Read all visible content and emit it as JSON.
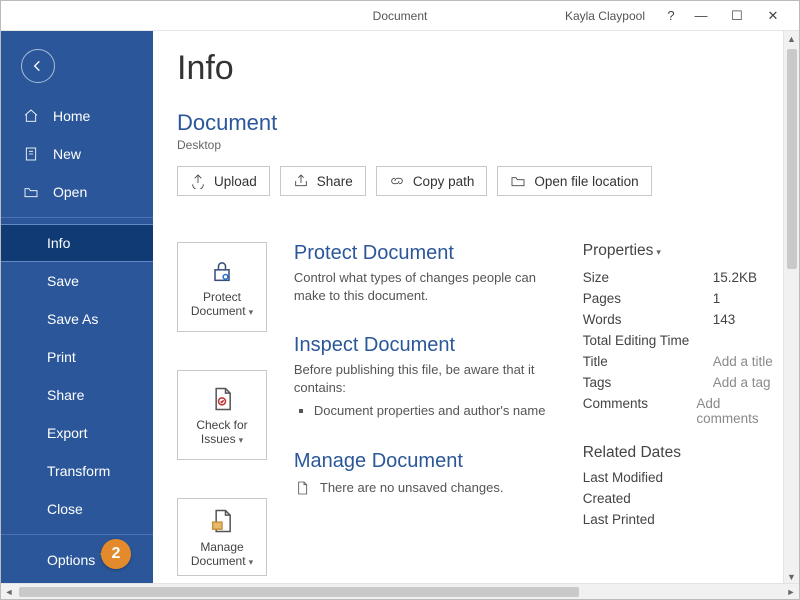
{
  "window": {
    "title": "Document",
    "user": "Kayla Claypool"
  },
  "sidebar": {
    "items": [
      {
        "label": "Home",
        "icon": true
      },
      {
        "label": "New",
        "icon": true
      },
      {
        "label": "Open",
        "icon": true
      },
      {
        "label": "Info",
        "icon": false,
        "active": true
      },
      {
        "label": "Save",
        "icon": false
      },
      {
        "label": "Save As",
        "icon": false
      },
      {
        "label": "Print",
        "icon": false
      },
      {
        "label": "Share",
        "icon": false
      },
      {
        "label": "Export",
        "icon": false
      },
      {
        "label": "Transform",
        "icon": false
      },
      {
        "label": "Close",
        "icon": false
      },
      {
        "label": "Options",
        "icon": false
      }
    ]
  },
  "page": {
    "title": "Info",
    "doc_name": "Document",
    "doc_location": "Desktop"
  },
  "actions": {
    "upload": "Upload",
    "share": "Share",
    "copy_path": "Copy path",
    "open_loc": "Open file location"
  },
  "sections": {
    "protect": {
      "tile": "Protect Document",
      "title": "Protect Document",
      "desc": "Control what types of changes people can make to this document."
    },
    "inspect": {
      "tile": "Check for Issues",
      "title": "Inspect Document",
      "desc": "Before publishing this file, be aware that it contains:",
      "bullet1": "Document properties and author's name"
    },
    "manage": {
      "tile": "Manage Document",
      "title": "Manage Document",
      "desc": "There are no unsaved changes."
    }
  },
  "properties": {
    "heading": "Properties",
    "rows": [
      {
        "k": "Size",
        "v": "15.2KB"
      },
      {
        "k": "Pages",
        "v": "1"
      },
      {
        "k": "Words",
        "v": "143"
      },
      {
        "k": "Total Editing Time",
        "v": ""
      },
      {
        "k": "Title",
        "v": "Add a title",
        "placeholder": true
      },
      {
        "k": "Tags",
        "v": "Add a tag",
        "placeholder": true
      },
      {
        "k": "Comments",
        "v": "Add comments",
        "placeholder": true
      }
    ],
    "related_heading": "Related Dates",
    "related": [
      {
        "k": "Last Modified",
        "v": ""
      },
      {
        "k": "Created",
        "v": ""
      },
      {
        "k": "Last Printed",
        "v": ""
      }
    ]
  },
  "callout": {
    "num": "2"
  }
}
